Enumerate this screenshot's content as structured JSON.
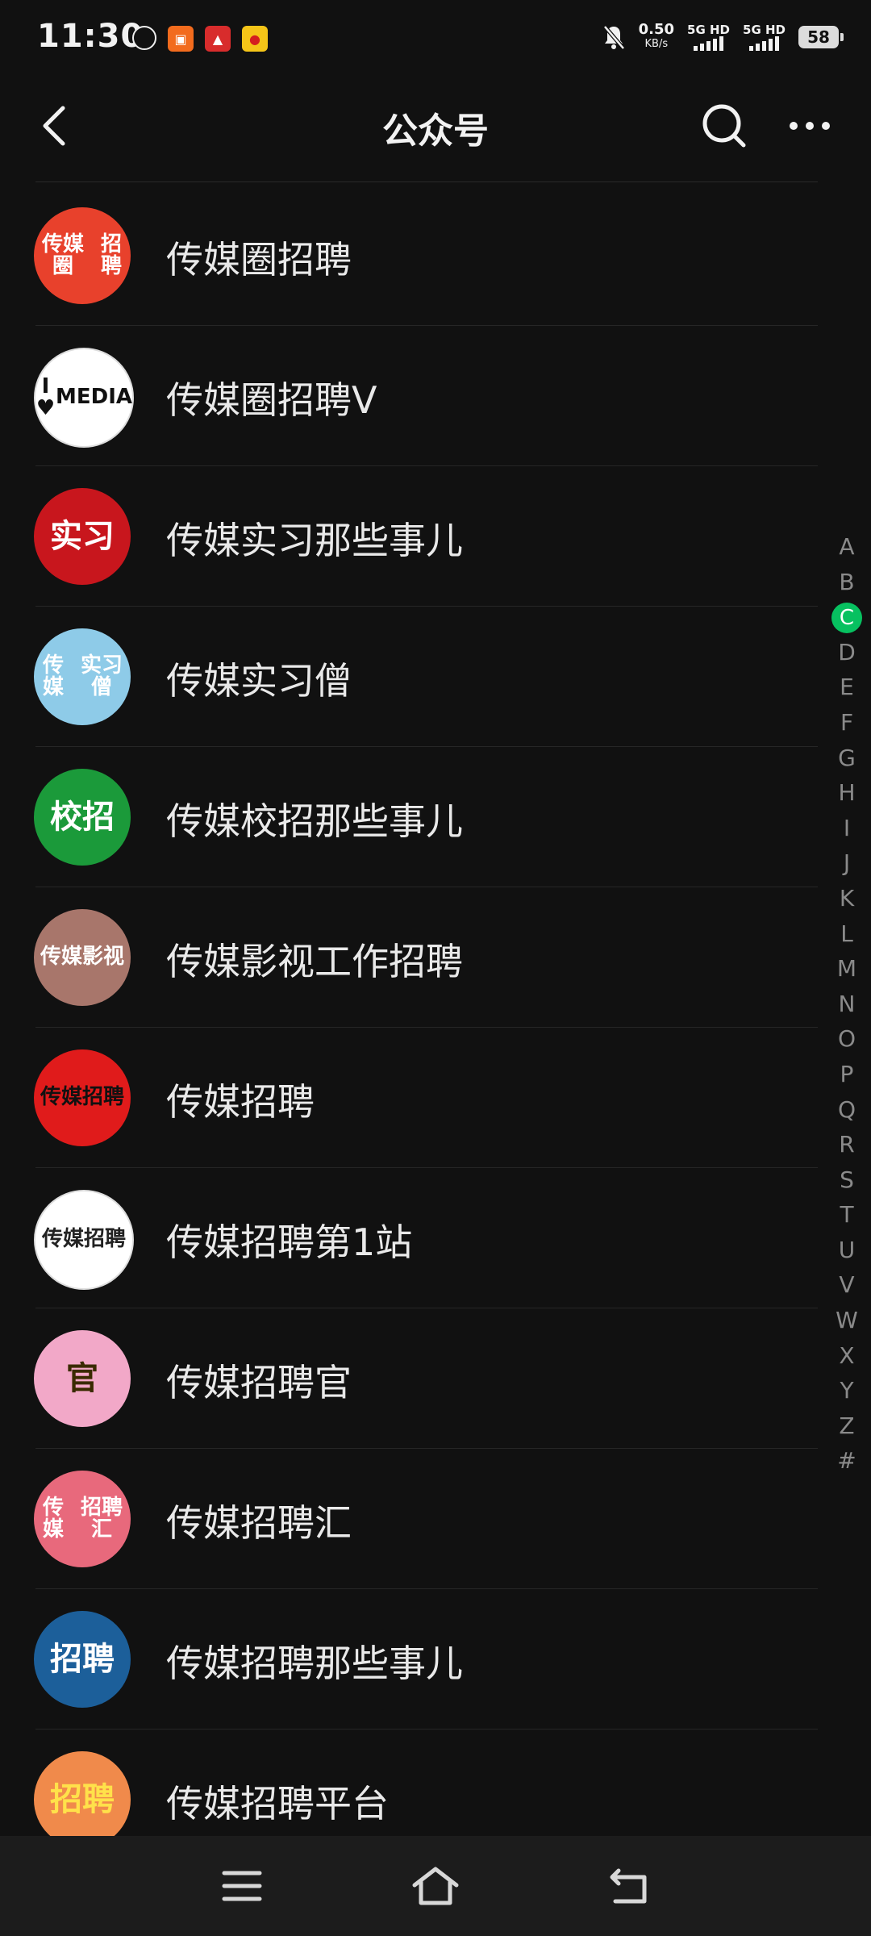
{
  "status_bar": {
    "time": "11:30",
    "net_speed": "0.50",
    "net_unit": "KB/s",
    "sim1": "5G HD",
    "sim2": "5G HD",
    "battery": "58"
  },
  "header": {
    "title": "公众号"
  },
  "accounts": [
    {
      "name": "传媒圈招聘",
      "avatar_text": "传媒圈\n招聘",
      "avatar_bg": "#e8412c",
      "avatar_fg": "#ffffff"
    },
    {
      "name": "传媒圈招聘V",
      "avatar_text": "I ♥\nMEDIA",
      "avatar_bg": "#ffffff",
      "avatar_fg": "#111111"
    },
    {
      "name": "传媒实习那些事儿",
      "avatar_text": "实习",
      "avatar_bg": "#c8161d",
      "avatar_fg": "#ffffff"
    },
    {
      "name": "传媒实习僧",
      "avatar_text": "传媒\n实习僧",
      "avatar_bg": "#8ecbe8",
      "avatar_fg": "#ffffff"
    },
    {
      "name": "传媒校招那些事儿",
      "avatar_text": "校招",
      "avatar_bg": "#1b9a3a",
      "avatar_fg": "#ffffff"
    },
    {
      "name": "传媒影视工作招聘",
      "avatar_text": "传媒\n影视",
      "avatar_bg": "#a8766b",
      "avatar_fg": "#ffffff"
    },
    {
      "name": "传媒招聘",
      "avatar_text": "传媒\n招聘",
      "avatar_bg": "#e01b1b",
      "avatar_fg": "#111111"
    },
    {
      "name": "传媒招聘第1站",
      "avatar_text": "传媒\n招聘",
      "avatar_bg": "#ffffff",
      "avatar_fg": "#222222"
    },
    {
      "name": "传媒招聘官",
      "avatar_text": "官",
      "avatar_bg": "#f2a8c8",
      "avatar_fg": "#3a2a00"
    },
    {
      "name": "传媒招聘汇",
      "avatar_text": "传媒\n招聘汇",
      "avatar_bg": "#e8697c",
      "avatar_fg": "#ffffff"
    },
    {
      "name": "传媒招聘那些事儿",
      "avatar_text": "招聘",
      "avatar_bg": "#1c5f9a",
      "avatar_fg": "#ffffff"
    },
    {
      "name": "传媒招聘平台",
      "avatar_text": "招聘",
      "avatar_bg": "#f08a4b",
      "avatar_fg": "#ffe14a"
    }
  ],
  "index_letters": [
    "A",
    "B",
    "C",
    "D",
    "E",
    "F",
    "G",
    "H",
    "I",
    "J",
    "K",
    "L",
    "M",
    "N",
    "O",
    "P",
    "Q",
    "R",
    "S",
    "T",
    "U",
    "V",
    "W",
    "X",
    "Y",
    "Z",
    "#"
  ],
  "index_active": "C",
  "accent_color": "#07c160"
}
